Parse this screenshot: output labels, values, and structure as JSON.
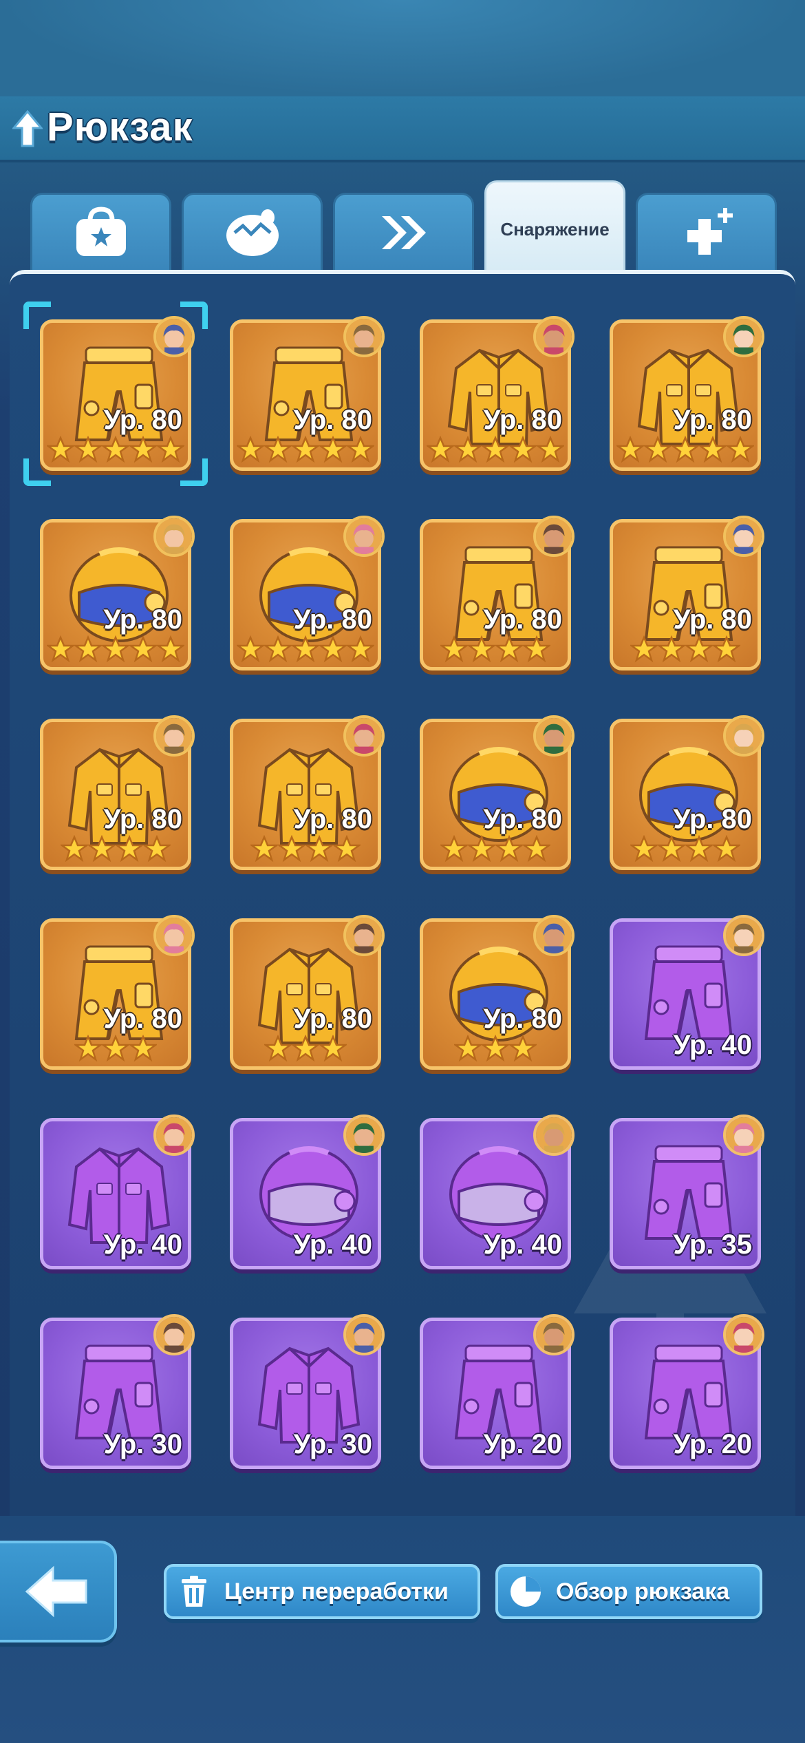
{
  "header": {
    "title": "Рюкзак",
    "back_icon": "up-arrow-icon"
  },
  "tabs": [
    {
      "icon": "bag-icon",
      "label": ""
    },
    {
      "icon": "egg-icon",
      "label": ""
    },
    {
      "icon": "double-chevron-icon",
      "label": ""
    },
    {
      "icon": "",
      "label": "Снаряжение",
      "active": true
    },
    {
      "icon": "plus-cross-icon",
      "label": ""
    }
  ],
  "items": [
    {
      "type": "pants",
      "rarity": "gold",
      "level": "Ур. 80",
      "stars": 5,
      "selected": true
    },
    {
      "type": "pants",
      "rarity": "gold",
      "level": "Ур. 80",
      "stars": 5
    },
    {
      "type": "jacket",
      "rarity": "gold",
      "level": "Ур. 80",
      "stars": 5
    },
    {
      "type": "jacket",
      "rarity": "gold",
      "level": "Ур. 80",
      "stars": 5
    },
    {
      "type": "helmet",
      "rarity": "gold",
      "level": "Ур. 80",
      "stars": 5
    },
    {
      "type": "helmet",
      "rarity": "gold",
      "level": "Ур. 80",
      "stars": 5
    },
    {
      "type": "pants",
      "rarity": "gold",
      "level": "Ур. 80",
      "stars": 4
    },
    {
      "type": "pants",
      "rarity": "gold",
      "level": "Ур. 80",
      "stars": 4
    },
    {
      "type": "jacket",
      "rarity": "gold",
      "level": "Ур. 80",
      "stars": 4
    },
    {
      "type": "jacket",
      "rarity": "gold",
      "level": "Ур. 80",
      "stars": 4
    },
    {
      "type": "helmet",
      "rarity": "gold",
      "level": "Ур. 80",
      "stars": 4
    },
    {
      "type": "helmet",
      "rarity": "gold",
      "level": "Ур. 80",
      "stars": 4
    },
    {
      "type": "pants",
      "rarity": "gold",
      "level": "Ур. 80",
      "stars": 3
    },
    {
      "type": "jacket",
      "rarity": "gold",
      "level": "Ур. 80",
      "stars": 3
    },
    {
      "type": "helmet",
      "rarity": "gold",
      "level": "Ур. 80",
      "stars": 3
    },
    {
      "type": "pants",
      "rarity": "purple",
      "level": "Ур. 40",
      "stars": 0
    },
    {
      "type": "jacket",
      "rarity": "purple",
      "level": "Ур. 40",
      "stars": 0
    },
    {
      "type": "helmet",
      "rarity": "purple",
      "level": "Ур. 40",
      "stars": 0
    },
    {
      "type": "helmet",
      "rarity": "purple",
      "level": "Ур. 40",
      "stars": 0
    },
    {
      "type": "pants",
      "rarity": "purple",
      "level": "Ур. 35",
      "stars": 0
    },
    {
      "type": "pants",
      "rarity": "purple",
      "level": "Ур. 30",
      "stars": 0
    },
    {
      "type": "jacket",
      "rarity": "purple",
      "level": "Ур. 30",
      "stars": 0
    },
    {
      "type": "pants",
      "rarity": "purple",
      "level": "Ур. 20",
      "stars": 0
    },
    {
      "type": "pants",
      "rarity": "purple",
      "level": "Ур. 20",
      "stars": 0
    }
  ],
  "footer": {
    "back_icon": "back-arrow-icon",
    "recycle_label": "Центр переработки",
    "recycle_icon": "trash-icon",
    "overview_label": "Обзор рюкзака",
    "overview_icon": "pie-chart-icon"
  },
  "colors": {
    "gold_frame": "#f7c46a",
    "purple_frame": "#c8a6f5",
    "selection": "#3fd0ef",
    "button_blue": "#3a97d6"
  }
}
